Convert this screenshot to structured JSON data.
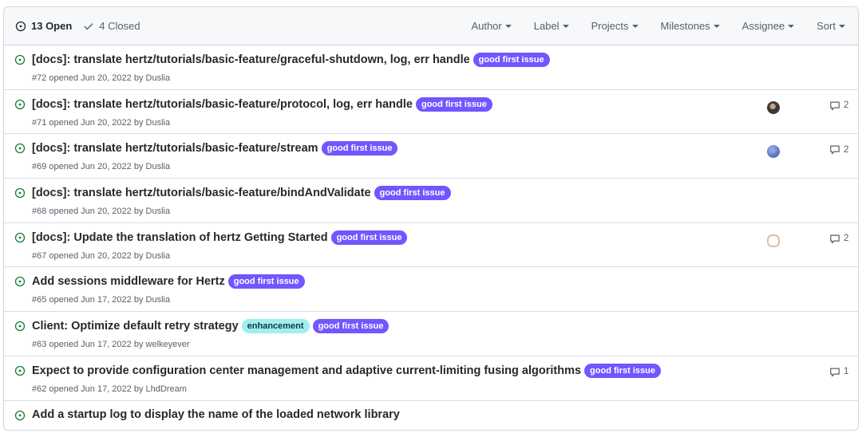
{
  "header": {
    "open_label": "13 Open",
    "closed_label": "4 Closed",
    "filters": [
      "Author",
      "Label",
      "Projects",
      "Milestones",
      "Assignee",
      "Sort"
    ]
  },
  "colors": {
    "open_icon": "#1a7f37",
    "label_good_first_issue": "#7057ff",
    "label_enhancement": "#a2eeef"
  },
  "issues": [
    {
      "title": "[docs]: translate hertz/tutorials/basic-feature/graceful-shutdown, log, err handle",
      "labels": [
        "good first issue"
      ],
      "meta": "#72 opened Jun 20, 2022 by Duslia",
      "comments": ""
    },
    {
      "title": "[docs]: translate hertz/tutorials/basic-feature/protocol, log, err handle",
      "labels": [
        "good first issue"
      ],
      "meta": "#71 opened Jun 20, 2022 by Duslia",
      "comments": "2"
    },
    {
      "title": "[docs]: translate hertz/tutorials/basic-feature/stream",
      "labels": [
        "good first issue"
      ],
      "meta": "#69 opened Jun 20, 2022 by Duslia",
      "comments": "2"
    },
    {
      "title": "[docs]: translate hertz/tutorials/basic-feature/bindAndValidate",
      "labels": [
        "good first issue"
      ],
      "meta": "#68 opened Jun 20, 2022 by Duslia",
      "comments": ""
    },
    {
      "title": "[docs]: Update the translation of hertz Getting Started",
      "labels": [
        "good first issue"
      ],
      "meta": "#67 opened Jun 20, 2022 by Duslia",
      "comments": "2"
    },
    {
      "title": "Add sessions middleware for Hertz",
      "labels": [
        "good first issue"
      ],
      "meta": "#65 opened Jun 17, 2022 by Duslia",
      "comments": ""
    },
    {
      "title": "Client: Optimize default retry strategy",
      "labels": [
        "enhancement",
        "good first issue"
      ],
      "meta": "#63 opened Jun 17, 2022 by welkeyever",
      "comments": ""
    },
    {
      "title": "Expect to provide configuration center management and adaptive current-limiting fusing algorithms",
      "labels": [
        "good first issue"
      ],
      "meta": "#62 opened Jun 17, 2022 by LhdDream",
      "comments": "1"
    },
    {
      "title": "Add a startup log to display the name of the loaded network library",
      "labels": [],
      "meta": "",
      "comments": ""
    }
  ]
}
